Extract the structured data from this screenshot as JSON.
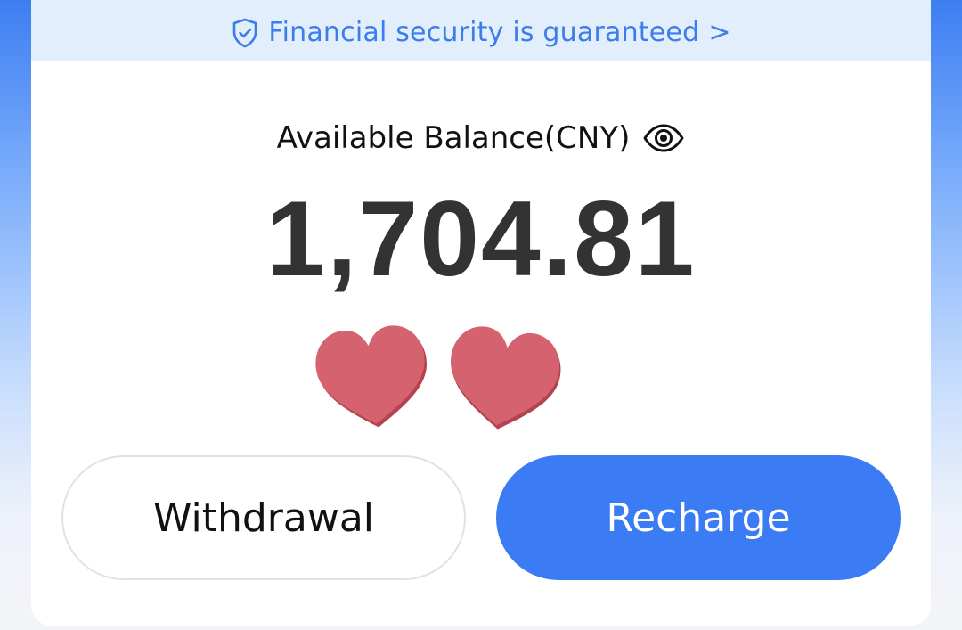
{
  "banner": {
    "text": "Financial security is guaranteed",
    "chevron": ">",
    "icon": "shield-check-icon",
    "color": "#3b7de9"
  },
  "balance": {
    "label": "Available Balance(CNY)",
    "amount": "1,704.81",
    "visibility_icon": "eye-icon"
  },
  "decorations": {
    "hearts": [
      "heart-icon",
      "heart-icon"
    ],
    "color": "#d4636f"
  },
  "actions": {
    "withdraw_label": "Withdrawal",
    "recharge_label": "Recharge",
    "accent_color": "#3b7cf4"
  }
}
